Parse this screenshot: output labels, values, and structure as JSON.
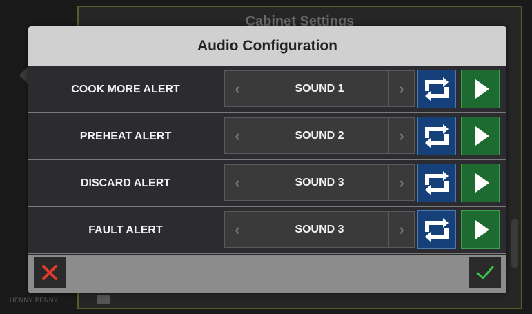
{
  "background": {
    "title": "Cabinet Settings",
    "brand": "HENNY PENNY"
  },
  "modal": {
    "title": "Audio Configuration",
    "rows": [
      {
        "label": "COOK MORE ALERT",
        "sound": "SOUND 1"
      },
      {
        "label": "PREHEAT ALERT",
        "sound": "SOUND 2"
      },
      {
        "label": "DISCARD ALERT",
        "sound": "SOUND 3"
      },
      {
        "label": "FAULT ALERT",
        "sound": "SOUND 3"
      }
    ],
    "prev_glyph": "‹",
    "next_glyph": "›",
    "repeat_count": "1"
  },
  "icons": {
    "prev": "chevron-left-icon",
    "next": "chevron-right-icon",
    "repeat": "repeat-once-icon",
    "play": "play-icon",
    "cancel": "close-icon",
    "confirm": "checkmark-icon"
  },
  "colors": {
    "header_bg": "#d0d0d0",
    "row_bg": "#2b2b30",
    "repeat_bg": "#15407a",
    "play_bg": "#1d6b30",
    "cancel": "#e03a2a",
    "confirm": "#3cc04a"
  }
}
